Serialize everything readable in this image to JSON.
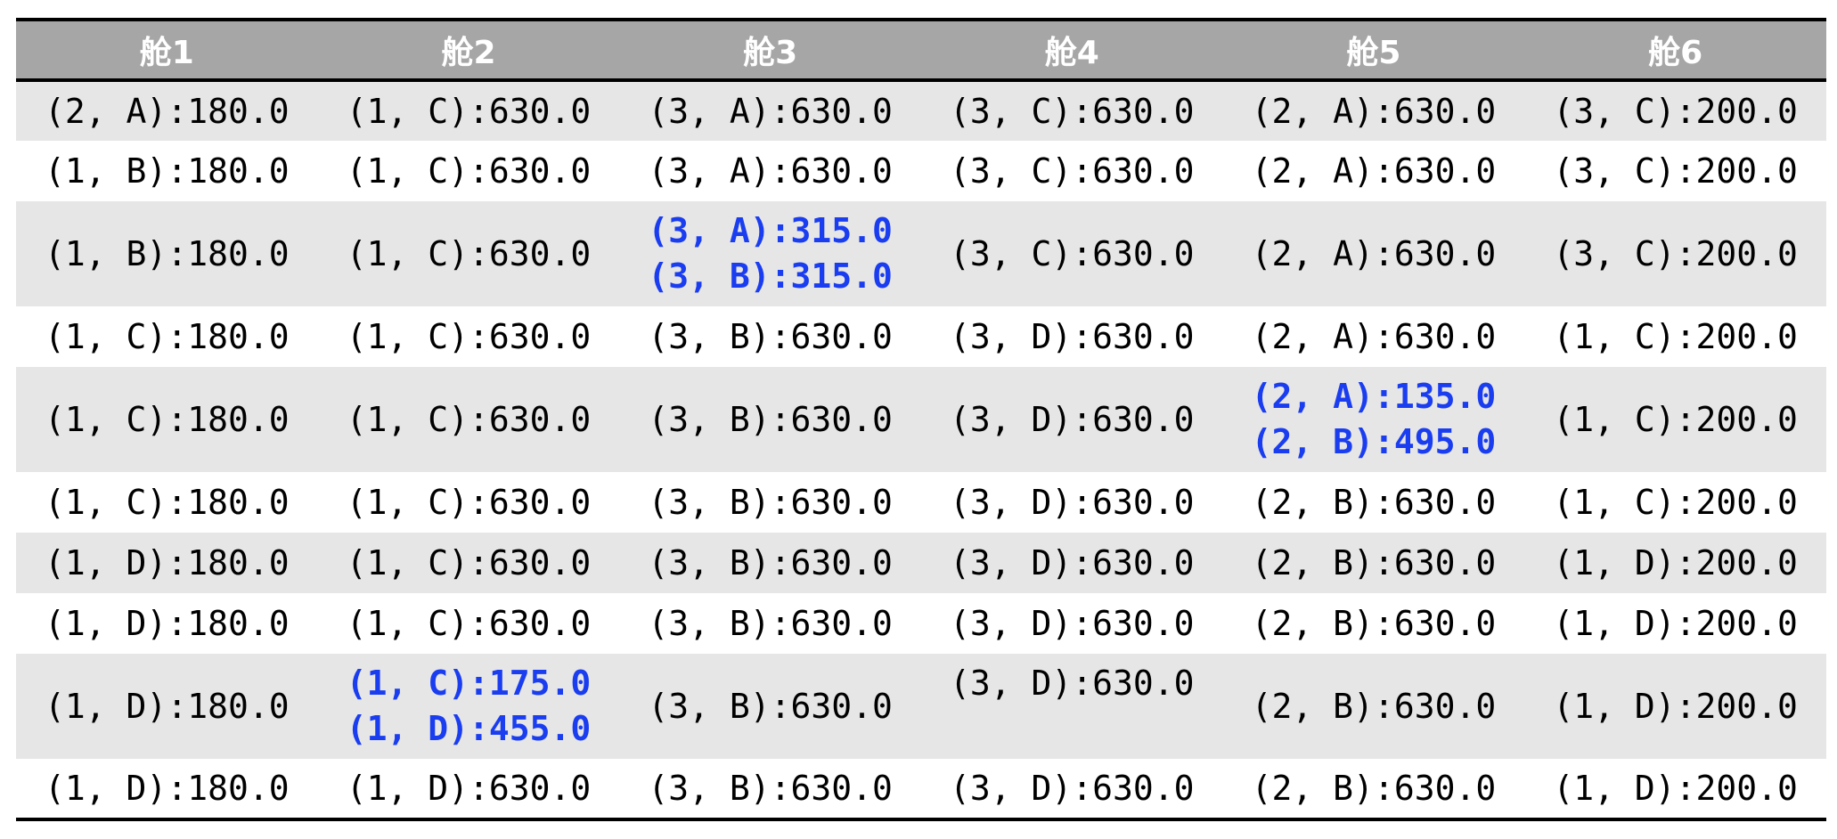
{
  "columns": [
    "舱1",
    "舱2",
    "舱3",
    "舱4",
    "舱5",
    "舱6"
  ],
  "rows": [
    {
      "cells": [
        [
          "(2, A):180.0"
        ],
        [
          "(1, C):630.0"
        ],
        [
          "(3, A):630.0"
        ],
        [
          "(3, C):630.0"
        ],
        [
          "(2, A):630.0"
        ],
        [
          "(3, C):200.0"
        ]
      ]
    },
    {
      "cells": [
        [
          "(1, B):180.0"
        ],
        [
          "(1, C):630.0"
        ],
        [
          "(3, A):630.0"
        ],
        [
          "(3, C):630.0"
        ],
        [
          "(2, A):630.0"
        ],
        [
          "(3, C):200.0"
        ]
      ]
    },
    {
      "cells": [
        [
          "(1, B):180.0"
        ],
        [
          "(1, C):630.0"
        ],
        [
          "(3, A):315.0",
          "(3, B):315.0"
        ],
        [
          "(3, C):630.0"
        ],
        [
          "(2, A):630.0"
        ],
        [
          "(3, C):200.0"
        ]
      ]
    },
    {
      "cells": [
        [
          "(1, C):180.0"
        ],
        [
          "(1, C):630.0"
        ],
        [
          "(3, B):630.0"
        ],
        [
          "(3, D):630.0"
        ],
        [
          "(2, A):630.0"
        ],
        [
          "(1, C):200.0"
        ]
      ]
    },
    {
      "cells": [
        [
          "(1, C):180.0"
        ],
        [
          "(1, C):630.0"
        ],
        [
          "(3, B):630.0"
        ],
        [
          "(3, D):630.0"
        ],
        [
          "(2, A):135.0",
          "(2, B):495.0"
        ],
        [
          "(1, C):200.0"
        ]
      ]
    },
    {
      "cells": [
        [
          "(1, C):180.0"
        ],
        [
          "(1, C):630.0"
        ],
        [
          "(3, B):630.0"
        ],
        [
          "(3, D):630.0"
        ],
        [
          "(2, B):630.0"
        ],
        [
          "(1, C):200.0"
        ]
      ]
    },
    {
      "cells": [
        [
          "(1, D):180.0"
        ],
        [
          "(1, C):630.0"
        ],
        [
          "(3, B):630.0"
        ],
        [
          "(3, D):630.0"
        ],
        [
          "(2, B):630.0"
        ],
        [
          "(1, D):200.0"
        ]
      ]
    },
    {
      "cells": [
        [
          "(1, D):180.0"
        ],
        [
          "(1, C):630.0"
        ],
        [
          "(3, B):630.0"
        ],
        [
          "(3, D):630.0"
        ],
        [
          "(2, B):630.0"
        ],
        [
          "(1, D):200.0"
        ]
      ]
    },
    {
      "cells": [
        [
          "(1, D):180.0"
        ],
        [
          "(1, C):175.0",
          "(1, D):455.0"
        ],
        [
          "(3, B):630.0"
        ],
        [
          "(3, D):630.0"
        ],
        [
          "(2, B):630.0"
        ],
        [
          "(1, D):200.0"
        ]
      ]
    },
    {
      "cells": [
        [
          "(1, D):180.0"
        ],
        [
          "(1, D):630.0"
        ],
        [
          "(3, B):630.0"
        ],
        [
          "(3, D):630.0"
        ],
        [
          "(2, B):630.0"
        ],
        [
          "(1, D):200.0"
        ]
      ]
    }
  ],
  "colors": {
    "header_bg": "#a6a6a6",
    "header_text": "#ffffff",
    "stripe_bg": "#e6e6e6",
    "highlight_text": "#1a3df0"
  }
}
